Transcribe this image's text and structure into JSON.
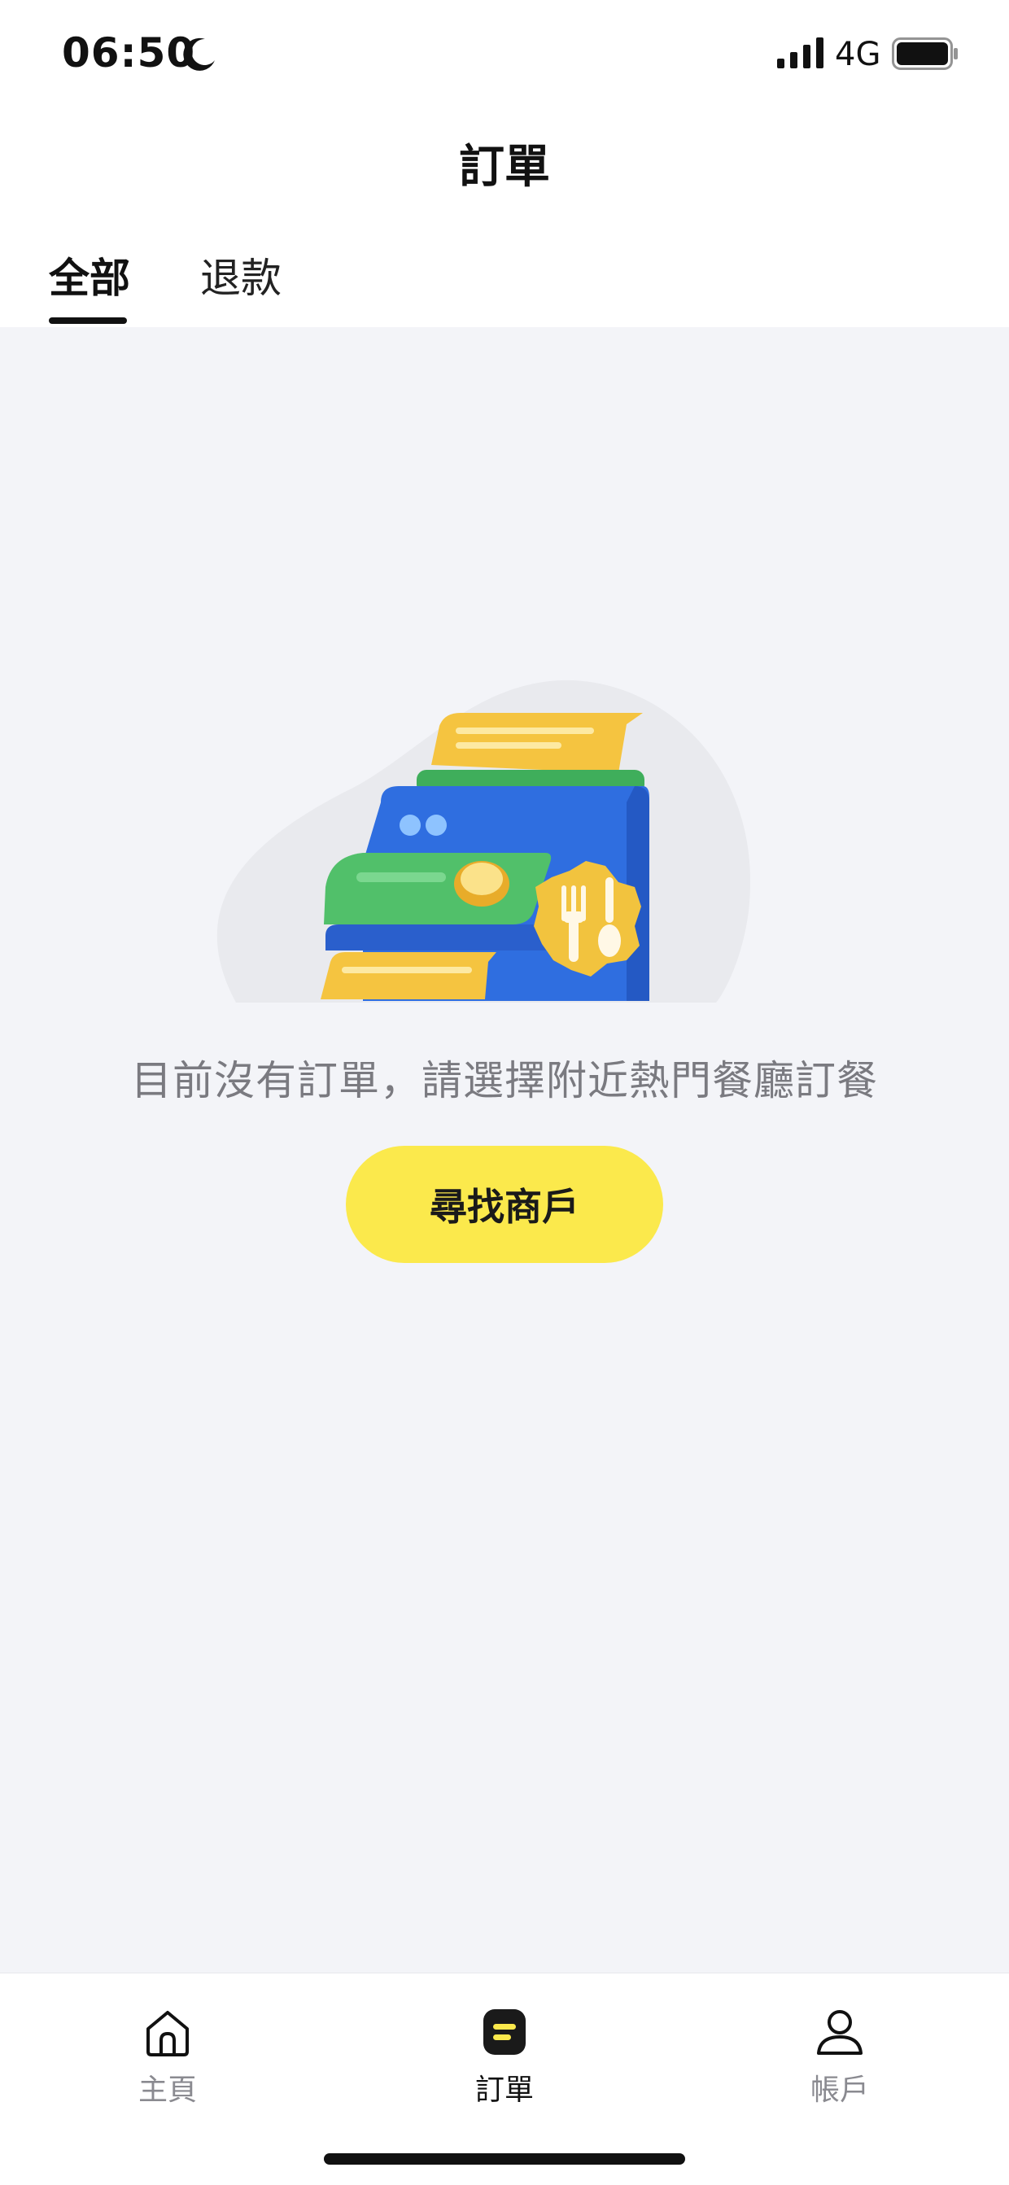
{
  "status_bar": {
    "time": "06:50",
    "network": "4G",
    "icons": [
      "moon-icon",
      "signal-icon",
      "battery-icon"
    ]
  },
  "header": {
    "title": "訂單"
  },
  "tabs": [
    {
      "label": "全部",
      "active": true
    },
    {
      "label": "退款",
      "active": false
    }
  ],
  "empty_state": {
    "illustration": "receipt-printer-illustration",
    "message": "目前沒有訂單，請選擇附近熱門餐廳訂餐",
    "button_label": "尋找商戶"
  },
  "bottom_nav": {
    "items": [
      {
        "label": "主頁",
        "icon": "home-icon",
        "active": false
      },
      {
        "label": "訂單",
        "icon": "orders-icon",
        "active": true
      },
      {
        "label": "帳戶",
        "icon": "account-icon",
        "active": false
      }
    ]
  },
  "colors": {
    "accent": "#fbe94c",
    "background": "#f3f4f8",
    "text_primary": "#111111",
    "text_secondary": "#7a7a80"
  }
}
